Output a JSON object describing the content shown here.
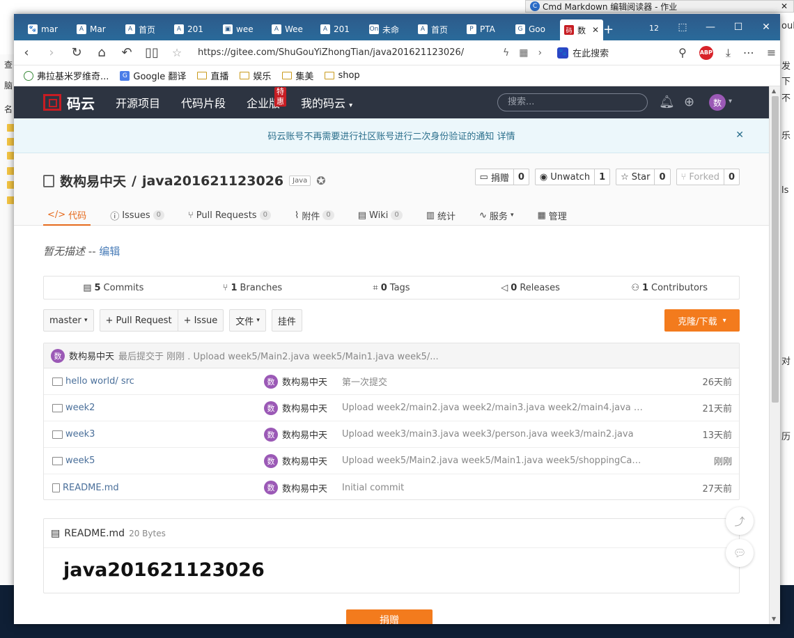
{
  "background": {
    "window_title": "Cmd Markdown 编辑阅读器 - 作业",
    "left_strip_chars": [
      "查",
      "脑",
      "名"
    ],
    "right_strip_chars": [
      "oul",
      "发",
      "下",
      "乐",
      "不",
      "",
      "ls",
      "对",
      "历"
    ]
  },
  "browser": {
    "tabs": [
      {
        "label": "mar",
        "icon": "paw-icon"
      },
      {
        "label": "Mar",
        "icon": "doc-icon"
      },
      {
        "label": "首页",
        "icon": "doc-icon"
      },
      {
        "label": "201",
        "icon": "doc-icon"
      },
      {
        "label": "wee",
        "icon": "qr-icon"
      },
      {
        "label": "Wee",
        "icon": "doc-icon"
      },
      {
        "label": "201",
        "icon": "doc-icon"
      },
      {
        "label": "未命",
        "icon": "on-icon"
      },
      {
        "label": "首页",
        "icon": "doc-icon"
      },
      {
        "label": "PTA",
        "icon": "pta-icon"
      },
      {
        "label": "Goo",
        "icon": "google-icon"
      },
      {
        "label": "数",
        "icon": "gitee-icon",
        "active": true
      }
    ],
    "tab_count": "12",
    "url": "https://gitee.com/ShuGouYiZhongTian/java201621123026/",
    "search_engine_label": "在此搜索",
    "bookmarks": [
      "弗拉基米罗维奇...",
      "Google 翻译",
      "直播",
      "娱乐",
      "集美",
      "shop"
    ]
  },
  "gitee": {
    "logo_text": "码云",
    "nav": [
      "开源项目",
      "代码片段",
      "企业版",
      "我的码云"
    ],
    "nav_hot_badge": "特惠",
    "search_placeholder": "搜索...",
    "avatar_char": "数",
    "notice_text": "码云账号不再需要进行社区账号进行二次身份验证的通知",
    "notice_link": "详情",
    "repo_owner": "数构易中天",
    "repo_sep": "/",
    "repo_name": "java201621123026",
    "repo_lang": "Java",
    "stat_buttons": [
      {
        "label": "捐赠",
        "count": "0"
      },
      {
        "label": "Unwatch",
        "count": "1"
      },
      {
        "label": "Star",
        "count": "0"
      },
      {
        "label": "Forked",
        "count": "0"
      }
    ],
    "repo_tabs": [
      {
        "label": "代码",
        "count": ""
      },
      {
        "label": "Issues",
        "count": "0"
      },
      {
        "label": "Pull Requests",
        "count": "0"
      },
      {
        "label": "附件",
        "count": "0"
      },
      {
        "label": "Wiki",
        "count": "0"
      },
      {
        "label": "统计",
        "count": ""
      },
      {
        "label": "服务",
        "count": ""
      },
      {
        "label": "管理",
        "count": ""
      }
    ],
    "description": "暂无描述",
    "description_sep": "--",
    "description_edit": "编辑",
    "stats": [
      {
        "num": "5",
        "label": "Commits"
      },
      {
        "num": "1",
        "label": "Branches"
      },
      {
        "num": "0",
        "label": "Tags"
      },
      {
        "num": "0",
        "label": "Releases"
      },
      {
        "num": "1",
        "label": "Contributors"
      }
    ],
    "branch": "master",
    "pull_request_btn": "+ Pull Request",
    "issue_btn": "+ Issue",
    "file_btn": "文件",
    "widget_btn": "挂件",
    "clone_btn": "克隆/下载",
    "last_commit": {
      "author": "数构易中天",
      "message": "最后提交于 刚刚 . Upload week5/Main2.java week5/Main1.java week5/..."
    },
    "files": [
      {
        "name": "hello world/ src",
        "type": "folder",
        "author": "数构易中天",
        "message": "第一次提交",
        "time": "26天前"
      },
      {
        "name": "week2",
        "type": "folder",
        "author": "数构易中天",
        "message": "Upload week2/main2.java week2/main3.java week2/main4.java week...",
        "time": "21天前"
      },
      {
        "name": "week3",
        "type": "folder",
        "author": "数构易中天",
        "message": "Upload week3/main3.java week3/person.java week3/main2.java",
        "time": "13天前"
      },
      {
        "name": "week5",
        "type": "folder",
        "author": "数构易中天",
        "message": "Upload week5/Main2.java week5/Main1.java week5/shoppingCar.java",
        "time": "刚刚"
      },
      {
        "name": "README.md",
        "type": "file",
        "author": "数构易中天",
        "message": "Initial commit",
        "time": "27天前"
      }
    ],
    "readme": {
      "filename": "README.md",
      "size": "20 Bytes",
      "heading": "java201621123026"
    },
    "donate_btn": "捐赠"
  }
}
